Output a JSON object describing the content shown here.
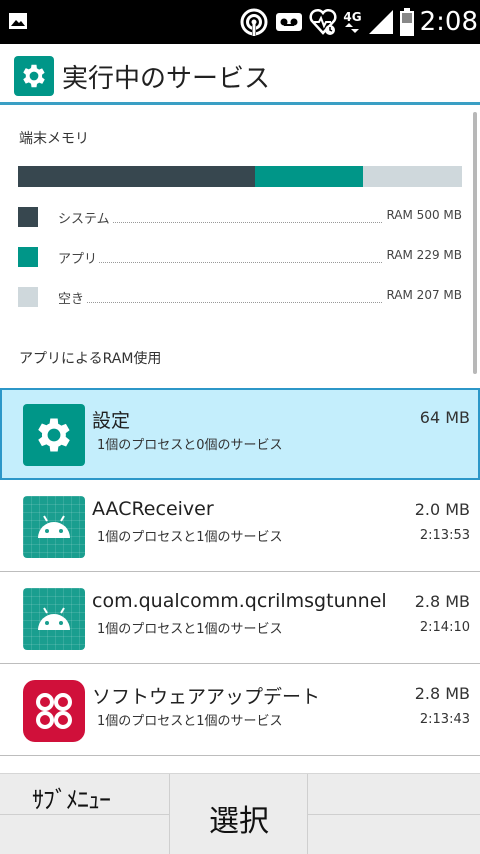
{
  "status_bar": {
    "time": "2:08",
    "network": "4G",
    "icons": [
      "picture-icon",
      "hotspot-icon",
      "voicemail-icon",
      "health-alarm-icon",
      "signal-icon",
      "battery-icon"
    ]
  },
  "app_bar": {
    "title": "実行中のサービス",
    "icon": "gear-icon"
  },
  "memory": {
    "section_title": "端末メモリ",
    "bar": {
      "system_fraction": 0.534,
      "app_fraction": 0.242,
      "free_fraction": 0.224
    },
    "legend": [
      {
        "label": "システム",
        "value": "RAM 500 MB",
        "color": "#37474f"
      },
      {
        "label": "アプリ",
        "value": "RAM 229 MB",
        "color": "#009688"
      },
      {
        "label": "空き",
        "value": "RAM 207 MB",
        "color": "#cfd8dc"
      }
    ]
  },
  "apps_section_title": "アプリによるRAM使用",
  "apps": [
    {
      "name": "設定",
      "desc": "1個のプロセスと0個のサービス",
      "size": "64 MB",
      "time": "",
      "icon": "gear-icon"
    },
    {
      "name": "AACReceiver",
      "desc": "1個のプロセスと1個のサービス",
      "size": "2.0 MB",
      "time": "2:13:53",
      "icon": "android-icon"
    },
    {
      "name": "com.qualcomm.qcrilmsgtunnel",
      "desc": "1個のプロセスと1個のサービス",
      "size": "2.8 MB",
      "time": "2:14:10",
      "icon": "android-icon"
    },
    {
      "name": "ソフトウェアアップデート",
      "desc": "1個のプロセスと1個のサービス",
      "size": "2.8 MB",
      "time": "2:13:43",
      "icon": "software-update-icon"
    }
  ],
  "softkeys": {
    "left": "ｻﾌﾞﾒﾆｭｰ",
    "center": "選択",
    "right": ""
  },
  "colors": {
    "accent": "#009688",
    "selected_bg": "#c4eefc",
    "selected_border": "#2c97c8",
    "system": "#37474f",
    "free": "#cfd8dc",
    "update_icon": "#d0103a"
  }
}
